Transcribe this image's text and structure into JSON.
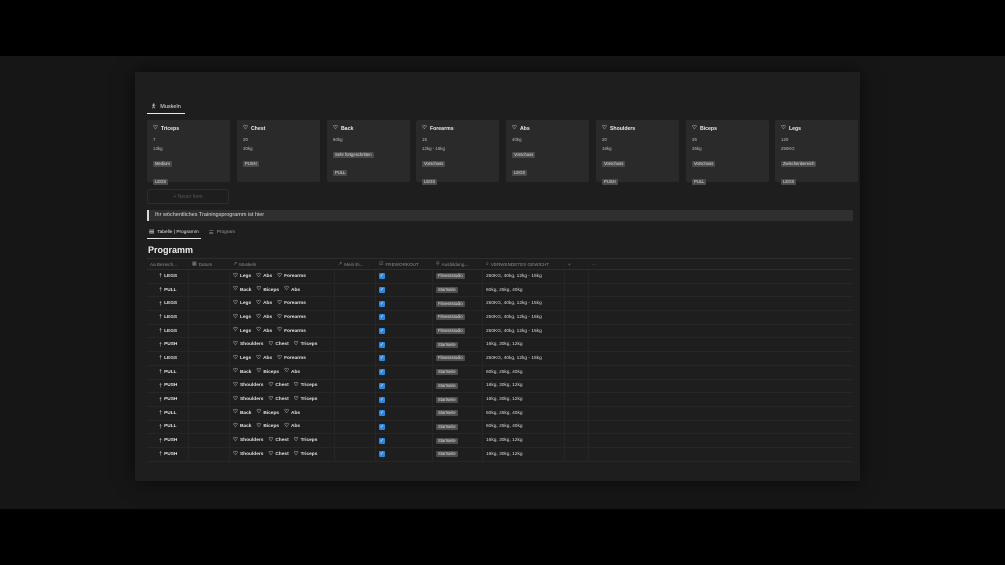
{
  "window_tab": {
    "label": "Muskeln",
    "icon": "figure-icon"
  },
  "cards": [
    {
      "title": "Triceps",
      "lines": [
        "7",
        "13kg"
      ],
      "chips": [
        "Medium",
        "LEGS"
      ]
    },
    {
      "title": "Chest",
      "lines": [
        "20",
        "30kg"
      ],
      "chips": [
        "PUSH"
      ]
    },
    {
      "title": "Back",
      "lines": [
        "60kg"
      ],
      "chips": [
        "Sehr fortgeschritten",
        "PULL"
      ]
    },
    {
      "title": "Forearms",
      "lines": [
        "15",
        "12kg - 15kg"
      ],
      "chips": [
        "Vorschuss",
        "LEGS"
      ]
    },
    {
      "title": "Abs",
      "lines": [
        "40kg"
      ],
      "chips": [
        "Vorschuss",
        "LEGS"
      ]
    },
    {
      "title": "Shoulders",
      "lines": [
        "20",
        "16kg"
      ],
      "chips": [
        "Vorschuss",
        "PUSH"
      ]
    },
    {
      "title": "Biceps",
      "lines": [
        "25",
        "25kg"
      ],
      "chips": [
        "Vorschuss",
        "PULL"
      ]
    },
    {
      "title": "Legs",
      "lines": [
        "120",
        "250KG"
      ],
      "chips": [
        "Zwischenbereich",
        "LEGS"
      ]
    }
  ],
  "new_item_label": "+ Neuer Item",
  "callout_text": "Ihr wöchentliches Trainingsprogramm ist hier",
  "view_tabs": [
    {
      "label": "Tabelle | Programm",
      "icon": "table-icon",
      "active": true
    },
    {
      "label": "Program",
      "icon": "list-icon",
      "active": false
    }
  ],
  "db_title": "Programm",
  "columns": [
    {
      "label": "Aa Bezeich...",
      "icon": ""
    },
    {
      "label": "Datum",
      "icon": "calendar-icon"
    },
    {
      "label": "Muskeln",
      "icon": "arrow-icon"
    },
    {
      "label": "Mein Ei...",
      "icon": "arrow-icon"
    },
    {
      "label": "FREWORKOUT",
      "icon": "checkbox-icon"
    },
    {
      "label": "Ausbildung...",
      "icon": "pin-icon"
    },
    {
      "label": "VERWENDETES GEWICHT",
      "icon": "search-icon"
    },
    {
      "label": "+",
      "icon": ""
    },
    {
      "label": "···",
      "icon": ""
    }
  ],
  "rows": [
    {
      "name": "LEGS",
      "muscles": [
        "Legs",
        "Abs",
        "Forearms"
      ],
      "place": "Fitnessstudio",
      "weight": "250KG, 40kg, 12kg - 15kg"
    },
    {
      "name": "PULL",
      "muscles": [
        "Back",
        "Biceps",
        "Abs"
      ],
      "place": "Startseite",
      "weight": "60kg, 25kg, 40kg"
    },
    {
      "name": "LEGS",
      "muscles": [
        "Legs",
        "Abs",
        "Forearms"
      ],
      "place": "Fitnessstudio",
      "weight": "250KG, 40kg, 12kg - 15kg"
    },
    {
      "name": "LEGS",
      "muscles": [
        "Legs",
        "Abs",
        "Forearms"
      ],
      "place": "Fitnessstudio",
      "weight": "250KG, 40kg, 12kg - 15kg"
    },
    {
      "name": "LEGS",
      "muscles": [
        "Legs",
        "Abs",
        "Forearms"
      ],
      "place": "Fitnessstudio",
      "weight": "250KG, 40kg, 12kg - 15kg"
    },
    {
      "name": "PUSH",
      "muscles": [
        "Shoulders",
        "Chest",
        "Triceps"
      ],
      "place": "Startseite",
      "weight": "16kg, 30kg, 12kg"
    },
    {
      "name": "LEGS",
      "muscles": [
        "Legs",
        "Abs",
        "Forearms"
      ],
      "place": "Fitnessstudio",
      "weight": "250KG, 40kg, 12kg - 15kg"
    },
    {
      "name": "PULL",
      "muscles": [
        "Back",
        "Biceps",
        "Abs"
      ],
      "place": "Startseite",
      "weight": "60kg, 25kg, 40kg"
    },
    {
      "name": "PUSH",
      "muscles": [
        "Shoulders",
        "Chest",
        "Triceps"
      ],
      "place": "Startseite",
      "weight": "16kg, 30kg, 12kg"
    },
    {
      "name": "PUSH",
      "muscles": [
        "Shoulders",
        "Chest",
        "Triceps"
      ],
      "place": "Startseite",
      "weight": "16kg, 30kg, 12kg"
    },
    {
      "name": "PULL",
      "muscles": [
        "Back",
        "Biceps",
        "Abs"
      ],
      "place": "Startseite",
      "weight": "60kg, 25kg, 40kg"
    },
    {
      "name": "PULL",
      "muscles": [
        "Back",
        "Biceps",
        "Abs"
      ],
      "place": "Startseite",
      "weight": "60kg, 25kg, 40kg"
    },
    {
      "name": "PUSH",
      "muscles": [
        "Shoulders",
        "Chest",
        "Triceps"
      ],
      "place": "Startseite",
      "weight": "16kg, 30kg, 12kg"
    },
    {
      "name": "PUSH",
      "muscles": [
        "Shoulders",
        "Chest",
        "Triceps"
      ],
      "place": "Startseite",
      "weight": "16kg, 30kg, 12kg"
    }
  ],
  "colors": {
    "checkbox": "#2e86de",
    "chip": "#4a4a4a",
    "panel": "#1e1e1e"
  }
}
